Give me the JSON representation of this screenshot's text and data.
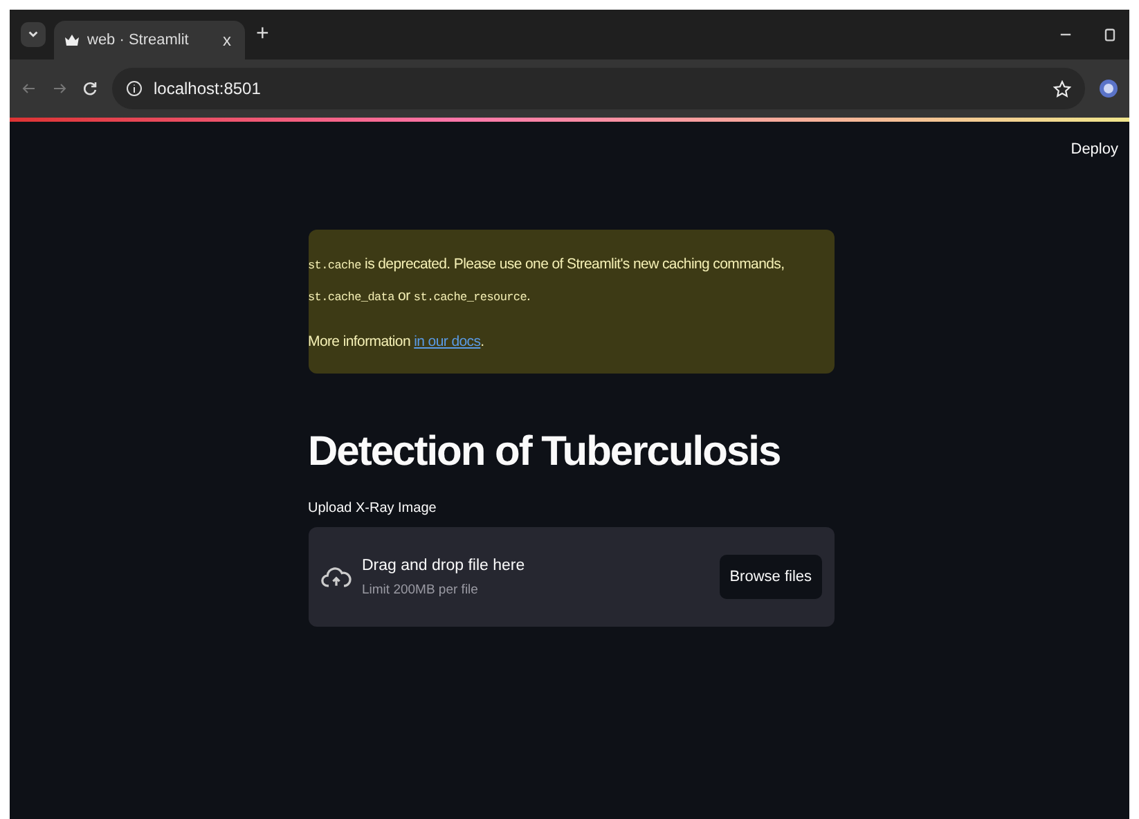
{
  "browser": {
    "tab": {
      "title": "web · Streamlit",
      "close": "x"
    },
    "new_tab": "+",
    "address": "localhost:8501"
  },
  "header": {
    "deploy": "Deploy"
  },
  "warning": {
    "lines": [
      [
        {
          "kind": "code",
          "text": "st.cache"
        },
        {
          "kind": "text",
          "text": " is deprecated. Please use one of Streamlit's new caching commands, "
        },
        {
          "kind": "code",
          "text": "st.cache_data"
        },
        {
          "kind": "text",
          "text": " or "
        },
        {
          "kind": "code",
          "text": "st.cache_resource"
        },
        {
          "kind": "text",
          "text": "."
        }
      ],
      [
        {
          "kind": "text",
          "text": "More information "
        },
        {
          "kind": "link",
          "text": "in our docs"
        },
        {
          "kind": "text",
          "text": "."
        }
      ]
    ]
  },
  "title": "Detection of Tuberculosis",
  "uploader": {
    "label": "Upload X-Ray Image",
    "instruction": "Drag and drop file here",
    "limit": "Limit 200MB per file",
    "button": "Browse files"
  }
}
